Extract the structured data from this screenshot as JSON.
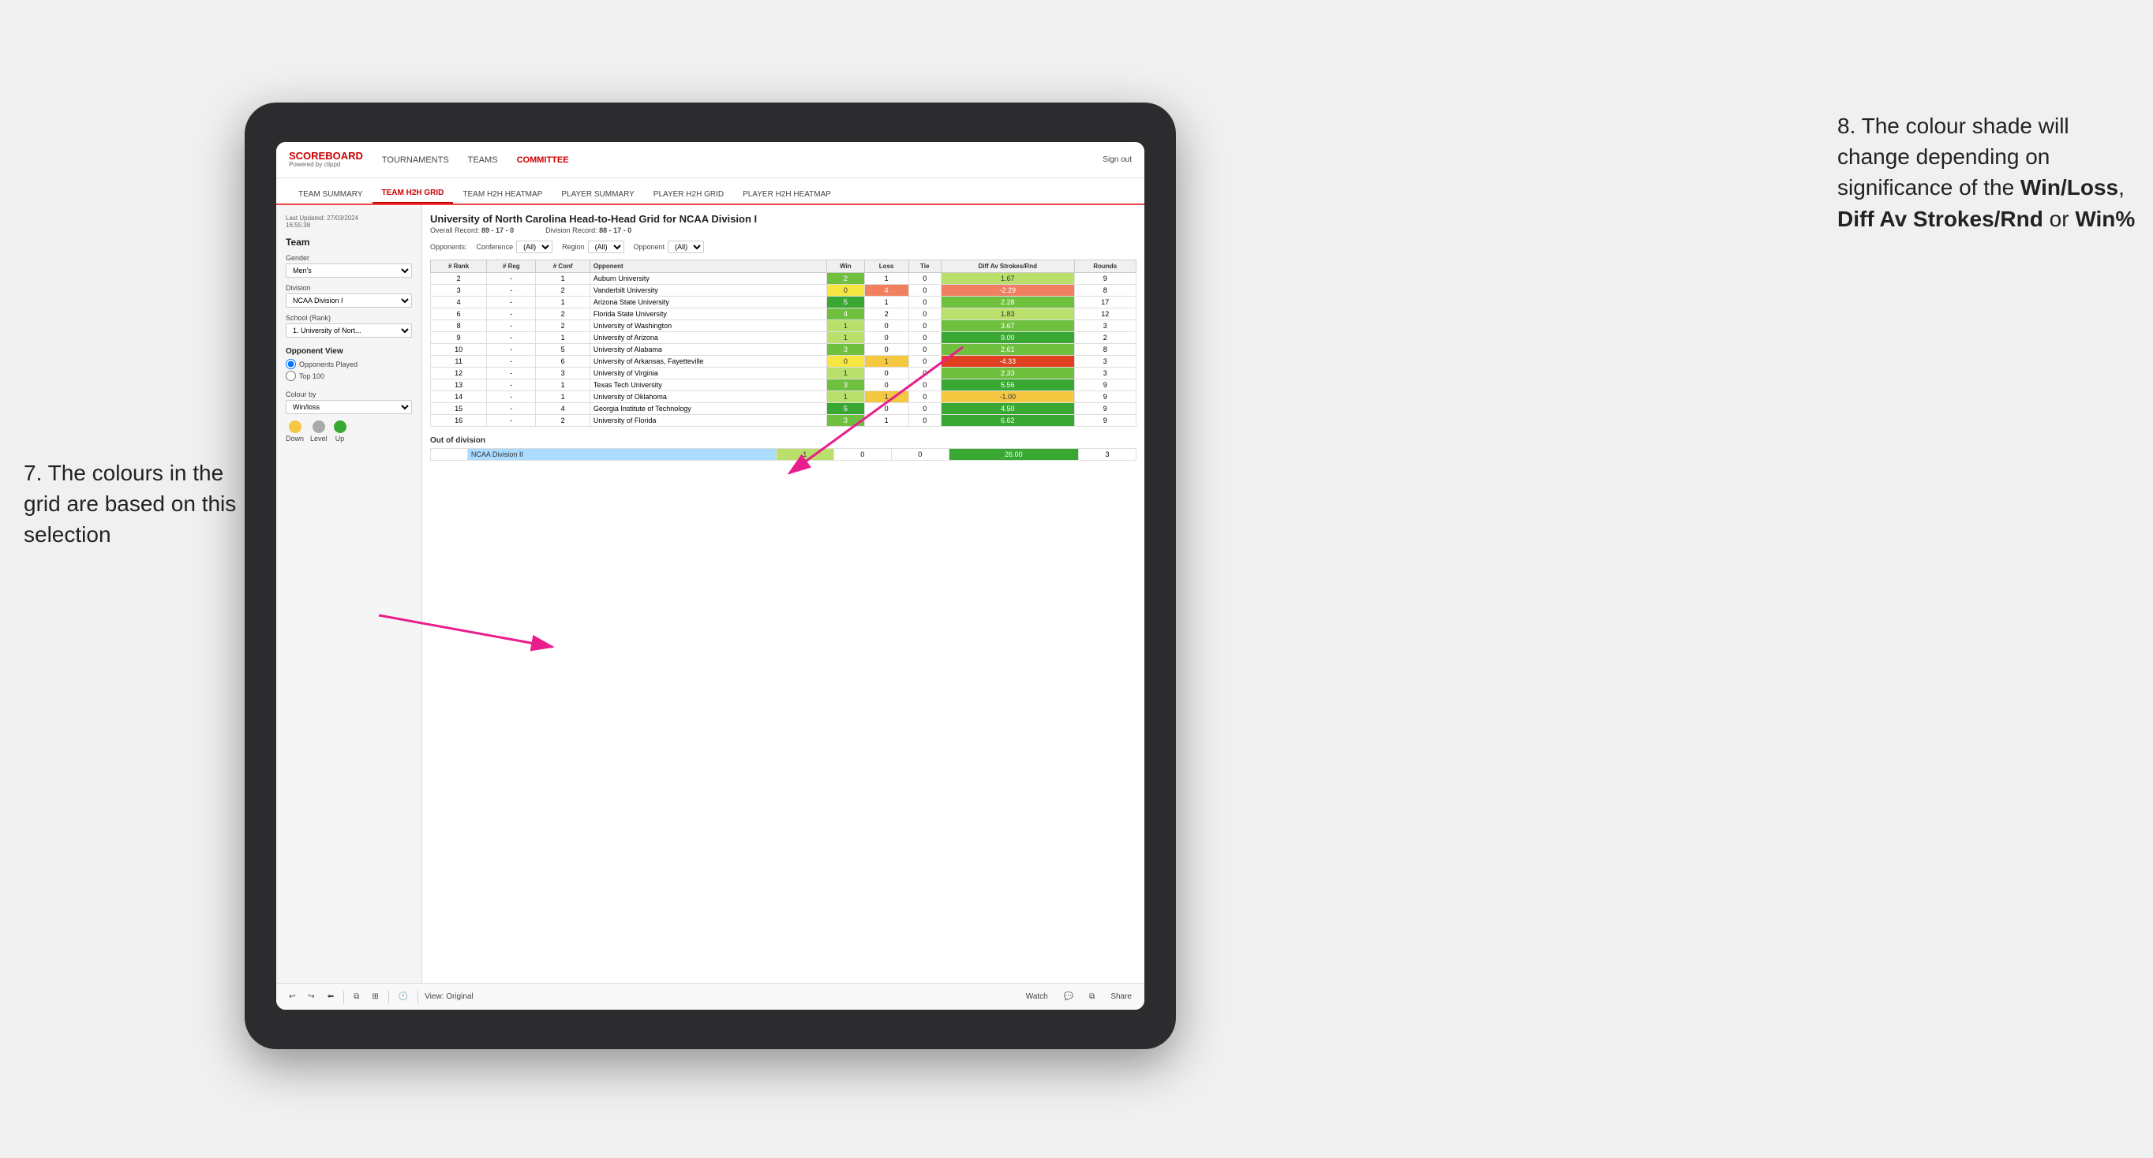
{
  "annotations": {
    "left": "7. The colours in the grid are based on this selection",
    "right_prefix": "8. The colour shade will change depending on significance of the ",
    "right_bold1": "Win/Loss",
    "right_sep1": ", ",
    "right_bold2": "Diff Av Strokes/Rnd",
    "right_sep2": " or ",
    "right_bold3": "Win%"
  },
  "header": {
    "logo_title": "SCOREBOARD",
    "logo_powered": "Powered by clippd",
    "nav": [
      "TOURNAMENTS",
      "TEAMS",
      "COMMITTEE"
    ],
    "active_nav": "COMMITTEE",
    "sign_out": "Sign out"
  },
  "sub_nav": {
    "items": [
      "TEAM SUMMARY",
      "TEAM H2H GRID",
      "TEAM H2H HEATMAP",
      "PLAYER SUMMARY",
      "PLAYER H2H GRID",
      "PLAYER H2H HEATMAP"
    ],
    "active": "TEAM H2H GRID"
  },
  "sidebar": {
    "last_updated_label": "Last Updated: 27/03/2024",
    "last_updated_time": "16:55:38",
    "team_label": "Team",
    "gender_label": "Gender",
    "gender_value": "Men's",
    "division_label": "Division",
    "division_value": "NCAA Division I",
    "school_label": "School (Rank)",
    "school_value": "1. University of Nort...",
    "opponent_view_label": "Opponent View",
    "opponents_played_label": "Opponents Played",
    "top100_label": "Top 100",
    "colour_by_label": "Colour by",
    "colour_by_value": "Win/loss",
    "legend_down": "Down",
    "legend_level": "Level",
    "legend_up": "Up"
  },
  "grid": {
    "title": "University of North Carolina Head-to-Head Grid for NCAA Division I",
    "overall_record_label": "Overall Record:",
    "overall_record_value": "89 - 17 - 0",
    "division_record_label": "Division Record:",
    "division_record_value": "88 - 17 - 0",
    "filters": {
      "conference_label": "Conference",
      "conference_value": "(All)",
      "opponents_label": "Opponents:",
      "region_label": "Region",
      "region_value": "(All)",
      "opponent_label": "Opponent",
      "opponent_value": "(All)"
    },
    "columns": [
      "# Rank",
      "# Reg",
      "# Conf",
      "Opponent",
      "Win",
      "Loss",
      "Tie",
      "Diff Av Strokes/Rnd",
      "Rounds"
    ],
    "rows": [
      {
        "rank": "2",
        "reg": "-",
        "conf": "1",
        "opponent": "Auburn University",
        "win": "2",
        "loss": "1",
        "tie": "0",
        "diff": "1.67",
        "rounds": "9",
        "win_color": "green_med",
        "loss_color": "white",
        "diff_color": "green_light"
      },
      {
        "rank": "3",
        "reg": "-",
        "conf": "2",
        "opponent": "Vanderbilt University",
        "win": "0",
        "loss": "4",
        "tie": "0",
        "diff": "-2.29",
        "rounds": "8",
        "win_color": "yellow",
        "loss_color": "red_light",
        "diff_color": "red_light"
      },
      {
        "rank": "4",
        "reg": "-",
        "conf": "1",
        "opponent": "Arizona State University",
        "win": "5",
        "loss": "1",
        "tie": "0",
        "diff": "2.28",
        "rounds": "17",
        "win_color": "green_dark",
        "loss_color": "white",
        "diff_color": "green_med"
      },
      {
        "rank": "6",
        "reg": "-",
        "conf": "2",
        "opponent": "Florida State University",
        "win": "4",
        "loss": "2",
        "tie": "0",
        "diff": "1.83",
        "rounds": "12",
        "win_color": "green_med",
        "loss_color": "white",
        "diff_color": "green_light"
      },
      {
        "rank": "8",
        "reg": "-",
        "conf": "2",
        "opponent": "University of Washington",
        "win": "1",
        "loss": "0",
        "tie": "0",
        "diff": "3.67",
        "rounds": "3",
        "win_color": "green_light",
        "loss_color": "white",
        "diff_color": "green_med"
      },
      {
        "rank": "9",
        "reg": "-",
        "conf": "1",
        "opponent": "University of Arizona",
        "win": "1",
        "loss": "0",
        "tie": "0",
        "diff": "9.00",
        "rounds": "2",
        "win_color": "green_light",
        "loss_color": "white",
        "diff_color": "green_dark"
      },
      {
        "rank": "10",
        "reg": "-",
        "conf": "5",
        "opponent": "University of Alabama",
        "win": "3",
        "loss": "0",
        "tie": "0",
        "diff": "2.61",
        "rounds": "8",
        "win_color": "green_med",
        "loss_color": "white",
        "diff_color": "green_med"
      },
      {
        "rank": "11",
        "reg": "-",
        "conf": "6",
        "opponent": "University of Arkansas, Fayetteville",
        "win": "0",
        "loss": "1",
        "tie": "0",
        "diff": "-4.33",
        "rounds": "3",
        "win_color": "yellow",
        "loss_color": "orange_light",
        "diff_color": "red"
      },
      {
        "rank": "12",
        "reg": "-",
        "conf": "3",
        "opponent": "University of Virginia",
        "win": "1",
        "loss": "0",
        "tie": "0",
        "diff": "2.33",
        "rounds": "3",
        "win_color": "green_light",
        "loss_color": "white",
        "diff_color": "green_med"
      },
      {
        "rank": "13",
        "reg": "-",
        "conf": "1",
        "opponent": "Texas Tech University",
        "win": "3",
        "loss": "0",
        "tie": "0",
        "diff": "5.56",
        "rounds": "9",
        "win_color": "green_med",
        "loss_color": "white",
        "diff_color": "green_dark"
      },
      {
        "rank": "14",
        "reg": "-",
        "conf": "1",
        "opponent": "University of Oklahoma",
        "win": "1",
        "loss": "1",
        "tie": "0",
        "diff": "-1.00",
        "rounds": "9",
        "win_color": "green_light",
        "loss_color": "orange_light",
        "diff_color": "orange_light"
      },
      {
        "rank": "15",
        "reg": "-",
        "conf": "4",
        "opponent": "Georgia Institute of Technology",
        "win": "5",
        "loss": "0",
        "tie": "0",
        "diff": "4.50",
        "rounds": "9",
        "win_color": "green_dark",
        "loss_color": "white",
        "diff_color": "green_dark"
      },
      {
        "rank": "16",
        "reg": "-",
        "conf": "2",
        "opponent": "University of Florida",
        "win": "3",
        "loss": "1",
        "tie": "0",
        "diff": "6.62",
        "rounds": "9",
        "win_color": "green_med",
        "loss_color": "white",
        "diff_color": "green_dark"
      }
    ],
    "out_of_division_label": "Out of division",
    "out_of_division_row": {
      "division": "NCAA Division II",
      "win": "1",
      "loss": "0",
      "tie": "0",
      "diff": "26.00",
      "rounds": "3",
      "win_color": "green_light",
      "diff_color": "green_dark"
    }
  },
  "toolbar": {
    "view_label": "View: Original",
    "watch_label": "Watch",
    "share_label": "Share"
  }
}
